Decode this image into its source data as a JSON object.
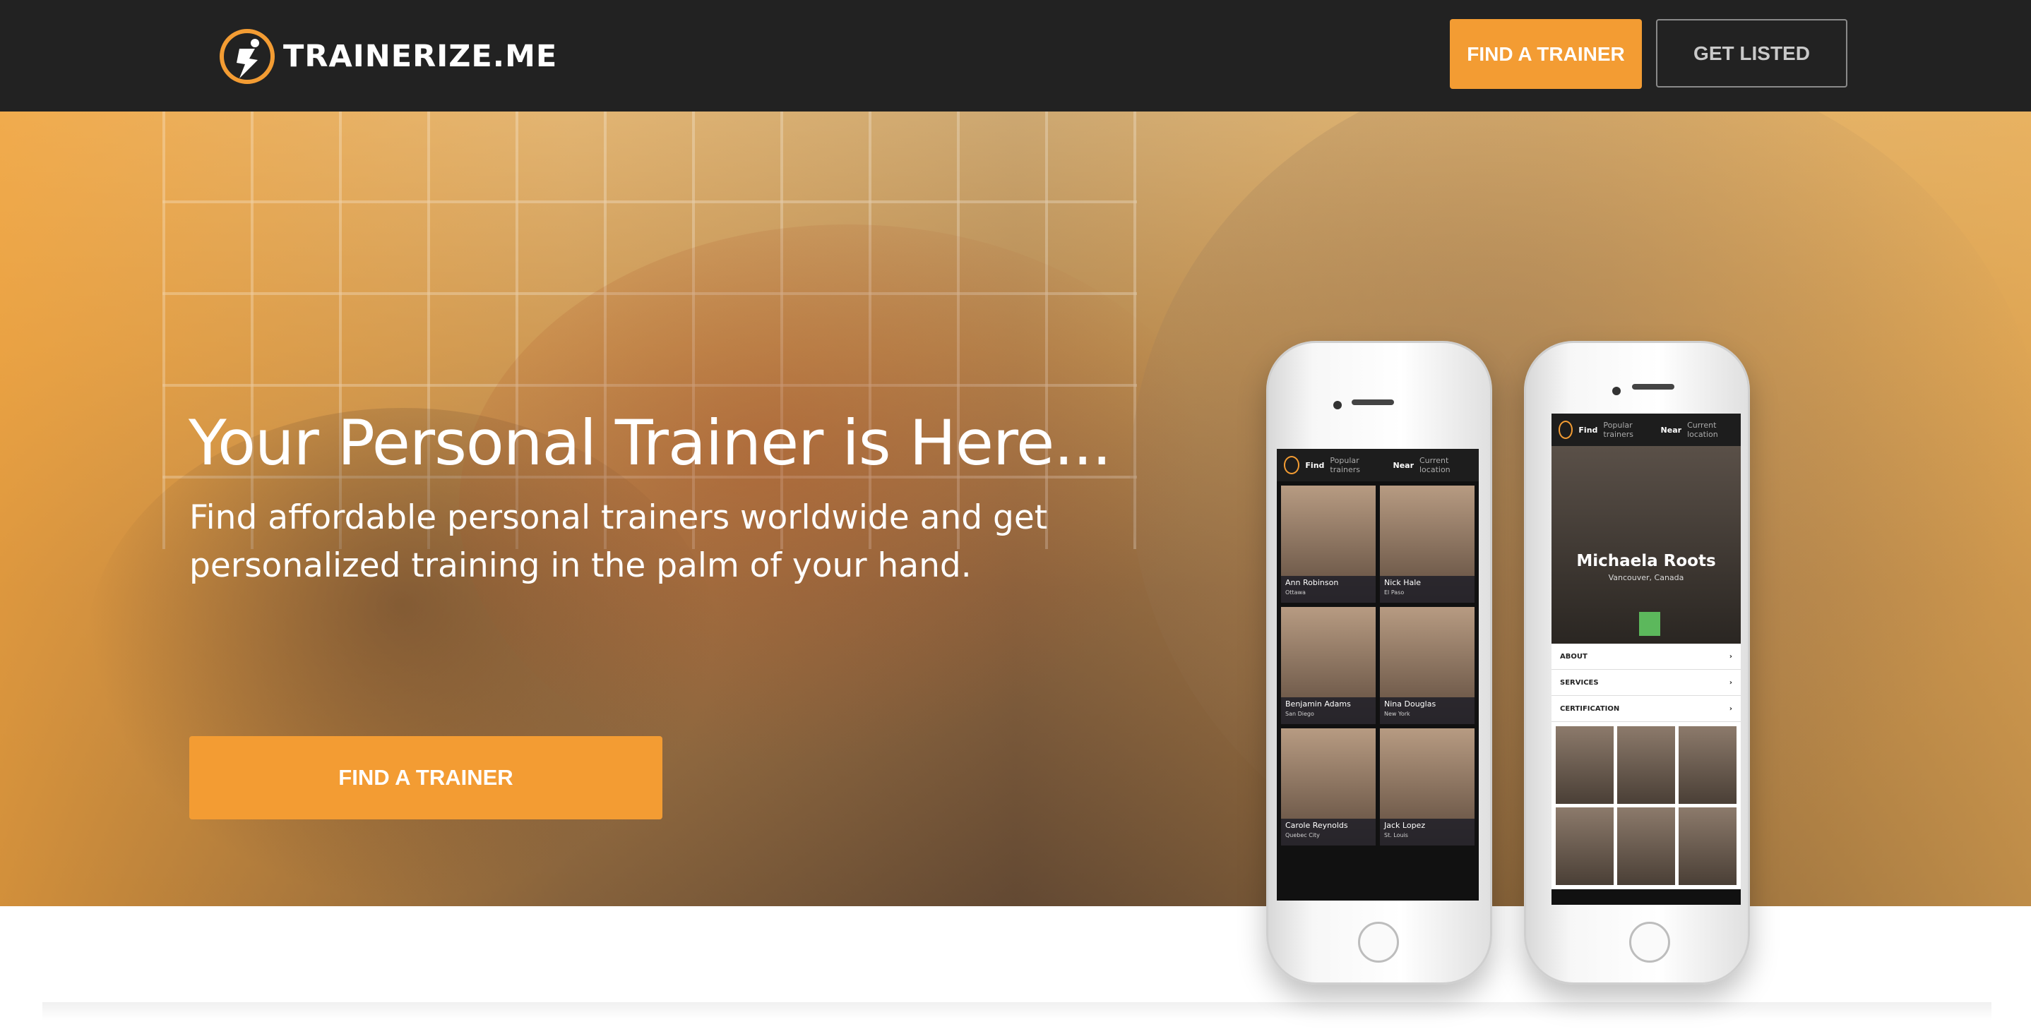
{
  "header": {
    "brand": "TRAINERIZE.ME",
    "find_trainer_label": "FIND A TRAINER",
    "get_listed_label": "GET LISTED"
  },
  "hero": {
    "headline": "Your Personal Trainer is Here...",
    "subline": "Find affordable personal trainers worldwide and get personalized training in the palm of your hand.",
    "cta_label": "FIND A TRAINER"
  },
  "phone_left": {
    "appbar_find": "Find",
    "appbar_find_hint": "Popular trainers",
    "appbar_near": "Near",
    "appbar_near_hint": "Current location",
    "trainers": [
      {
        "name": "Ann Robinson",
        "location": "Ottawa"
      },
      {
        "name": "Nick Hale",
        "location": "El Paso"
      },
      {
        "name": "Benjamin Adams",
        "location": "San Diego"
      },
      {
        "name": "Nina Douglas",
        "location": "New York"
      },
      {
        "name": "Carole Reynolds",
        "location": "Quebec City"
      },
      {
        "name": "Jack Lopez",
        "location": "St. Louis"
      }
    ]
  },
  "phone_right": {
    "appbar_find": "Find",
    "appbar_find_hint": "Popular trainers",
    "appbar_near": "Near",
    "appbar_near_hint": "Current location",
    "profile_name": "Michaela Roots",
    "profile_location": "Vancouver, Canada",
    "menu": [
      "ABOUT",
      "SERVICES",
      "CERTIFICATION"
    ]
  },
  "colors": {
    "accent": "#f39c33",
    "header_bg": "#222222"
  }
}
